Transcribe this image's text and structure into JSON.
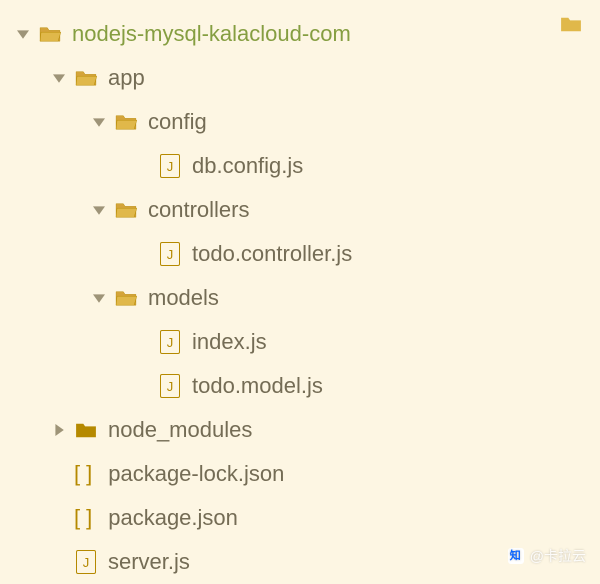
{
  "tree": {
    "root": {
      "label": "nodejs-mysql-kalacloud-com",
      "expanded": true
    },
    "items": [
      {
        "label": "app",
        "type": "folder-open",
        "indent": 1,
        "expanded": true
      },
      {
        "label": "config",
        "type": "folder-open",
        "indent": 2,
        "expanded": true
      },
      {
        "label": "db.config.js",
        "type": "file-js",
        "indent": 3
      },
      {
        "label": "controllers",
        "type": "folder-open",
        "indent": 2,
        "expanded": true
      },
      {
        "label": "todo.controller.js",
        "type": "file-js",
        "indent": 3
      },
      {
        "label": "models",
        "type": "folder-open",
        "indent": 2,
        "expanded": true
      },
      {
        "label": "index.js",
        "type": "file-js",
        "indent": 3
      },
      {
        "label": "todo.model.js",
        "type": "file-js",
        "indent": 3
      },
      {
        "label": "node_modules",
        "type": "folder-closed",
        "indent": 1,
        "expanded": false
      },
      {
        "label": "package-lock.json",
        "type": "file-generic",
        "indent": 1
      },
      {
        "label": "package.json",
        "type": "file-generic",
        "indent": 1
      },
      {
        "label": "server.js",
        "type": "file-js",
        "indent": 1
      }
    ]
  },
  "watermark": {
    "text": "@卡拉云"
  }
}
